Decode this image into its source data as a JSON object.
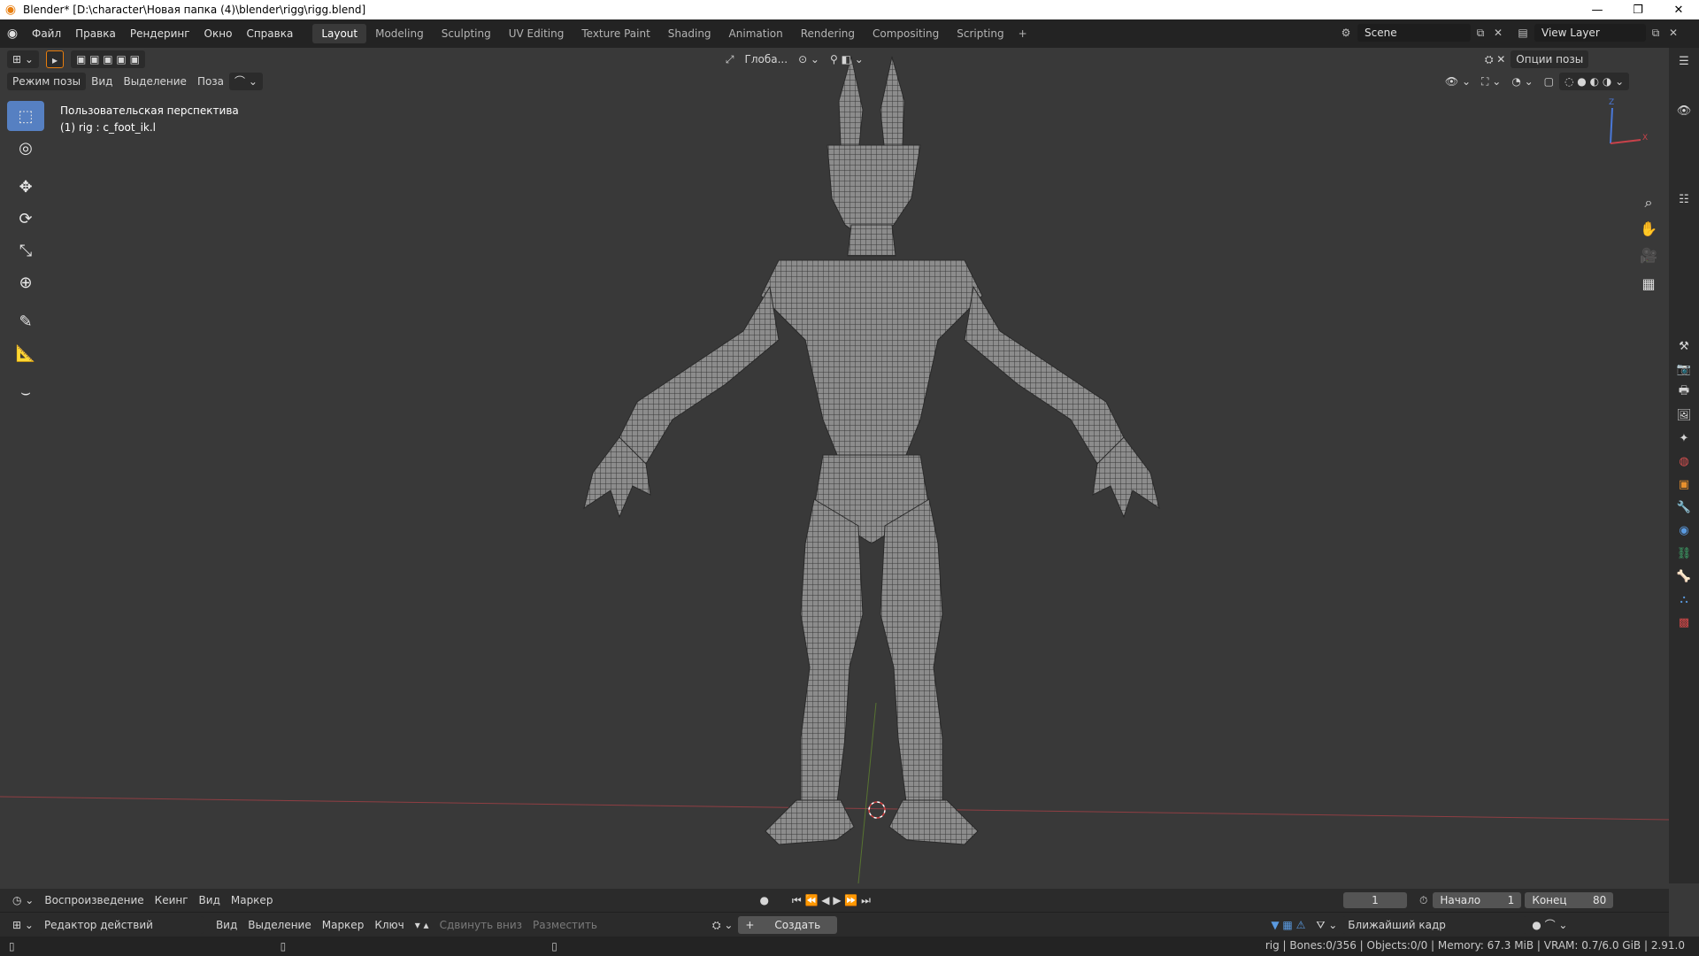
{
  "window": {
    "title": "Blender* [D:\\character\\Новая папка (4)\\blender\\rigg\\rigg.blend]",
    "minimize": "—",
    "maximize": "❐",
    "close": "✕"
  },
  "menu": [
    "Файл",
    "Правка",
    "Рендеринг",
    "Окно",
    "Справка"
  ],
  "workspaces": [
    "Layout",
    "Modeling",
    "Sculpting",
    "UV Editing",
    "Texture Paint",
    "Shading",
    "Animation",
    "Rendering",
    "Compositing",
    "Scripting"
  ],
  "active_workspace": "Layout",
  "add_workspace": "+",
  "scene": {
    "name": "Scene",
    "view_layer": "View Layer"
  },
  "viewport": {
    "transform_orientation": "Глоба...",
    "pose_options": "Опции позы",
    "mode": "Режим позы",
    "menus": [
      "Вид",
      "Выделение",
      "Поза"
    ],
    "perspective_label": "Пользовательская перспектива",
    "active_object": "(1) rig : c_foot_ik.l",
    "axis_x": "X",
    "axis_z": "Z"
  },
  "toolbar": [
    "select-box-icon",
    "cursor-icon",
    "move-icon",
    "rotate-icon",
    "scale-icon",
    "transform-icon",
    "annotate-icon",
    "measure-icon",
    "bend-icon"
  ],
  "timeline": {
    "playback": "Воспроизведение",
    "keying": "Кеинг",
    "view": "Вид",
    "marker": "Маркер",
    "current_frame": "1",
    "start_label": "Начало",
    "start": "1",
    "end_label": "Конец",
    "end": "80"
  },
  "action_editor": {
    "mode": "Редактор действий",
    "menus": [
      "Вид",
      "Выделение",
      "Маркер",
      "Ключ"
    ],
    "push_down": "Сдвинуть вниз",
    "stash": "Разместить",
    "create": "Создать",
    "snap": "Ближайший кадр"
  },
  "status": "rig | Bones:0/356 | Objects:0/0 | Memory: 67.3 MiB | VRAM: 0.7/6.0 GiB | 2.91.0",
  "colors": {
    "accent": "#5680c2",
    "x_axis": "#c8424a",
    "y_axis": "#6c9a2c",
    "z_axis": "#4a78d8"
  }
}
